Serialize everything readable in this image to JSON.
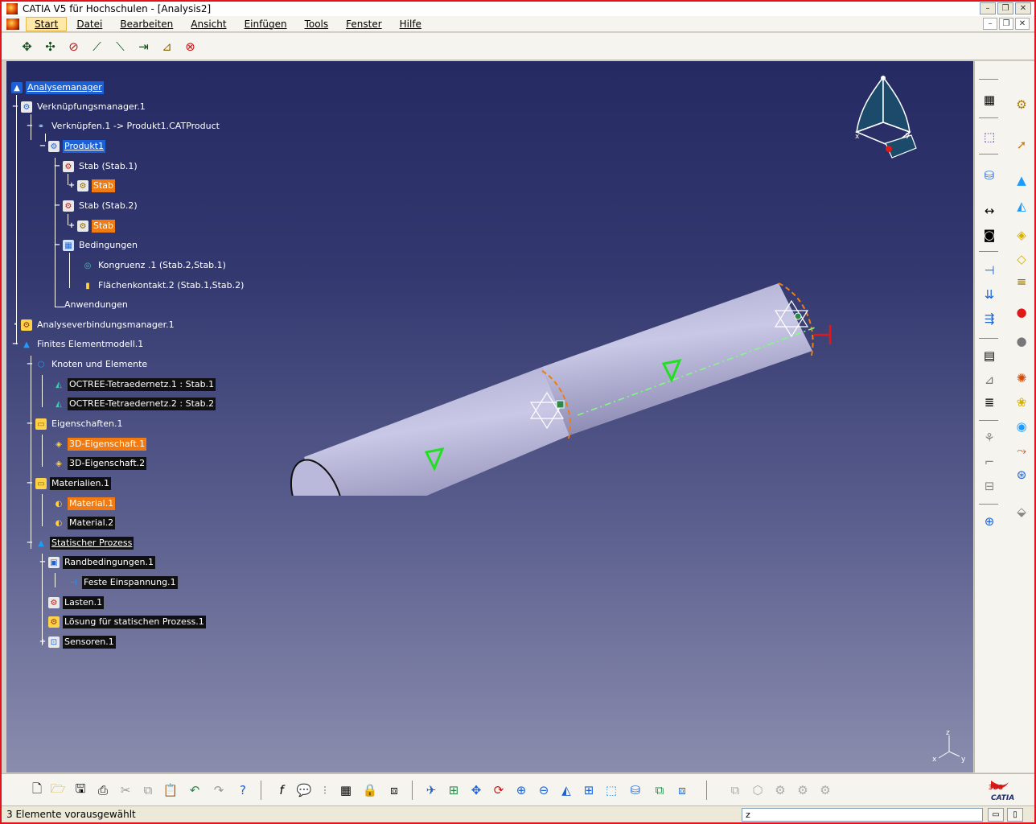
{
  "window": {
    "title": "CATIA V5 für Hochschulen - [Analysis2]",
    "minimize": "–",
    "restore": "❐",
    "close": "✕"
  },
  "menubar": {
    "items": [
      "Start",
      "Datei",
      "Bearbeiten",
      "Ansicht",
      "Einfügen",
      "Tools",
      "Fenster",
      "Hilfe"
    ],
    "active": "Start"
  },
  "tree": {
    "nodes": [
      {
        "label": "Analysemanager",
        "style": "hl",
        "icon": "analysis-manager-icon"
      },
      {
        "label": "Verknüpfungsmanager.1",
        "style": "plain",
        "icon": "link-manager-icon"
      },
      {
        "label": "Verknüpfen.1 -> Produkt1.CATProduct",
        "style": "plain",
        "icon": "link-icon"
      },
      {
        "label": "Produkt1",
        "style": "hl",
        "icon": "product-icon"
      },
      {
        "label": "Stab (Stab.1)",
        "style": "plain",
        "icon": "part-instance-icon"
      },
      {
        "label": "Stab",
        "style": "orange",
        "icon": "part-icon"
      },
      {
        "label": "Stab (Stab.2)",
        "style": "plain",
        "icon": "part-instance-icon"
      },
      {
        "label": "Stab",
        "style": "orange",
        "icon": "part-icon"
      },
      {
        "label": "Bedingungen",
        "style": "plain",
        "icon": "constraints-icon"
      },
      {
        "label": "Kongruenz .1 (Stab.2,Stab.1)",
        "style": "plain",
        "icon": "coincidence-icon"
      },
      {
        "label": "Flächenkontakt.2 (Stab.1,Stab.2)",
        "style": "plain",
        "icon": "contact-icon"
      },
      {
        "label": "Anwendungen",
        "style": "plain",
        "icon": ""
      },
      {
        "label": "Analyseverbindungsmanager.1",
        "style": "plain",
        "icon": "connection-manager-icon"
      },
      {
        "label": "Finites Elementmodell.1",
        "style": "plain",
        "icon": "fem-model-icon"
      },
      {
        "label": "Knoten und Elemente",
        "style": "plain",
        "icon": "nodes-elements-icon"
      },
      {
        "label": "OCTREE-Tetraedernetz.1 : Stab.1",
        "style": "dark",
        "icon": "mesh-icon"
      },
      {
        "label": "OCTREE-Tetraedernetz.2 : Stab.2",
        "style": "dark",
        "icon": "mesh-icon"
      },
      {
        "label": "Eigenschaften.1",
        "style": "plain",
        "icon": "properties-icon"
      },
      {
        "label": "3D-Eigenschaft.1",
        "style": "orange",
        "icon": "3d-property-icon"
      },
      {
        "label": "3D-Eigenschaft.2",
        "style": "dark",
        "icon": "3d-property-icon"
      },
      {
        "label": "Materialien.1",
        "style": "dark",
        "icon": "materials-icon"
      },
      {
        "label": "Material.1",
        "style": "orange",
        "icon": "material-icon"
      },
      {
        "label": "Material.2",
        "style": "dark",
        "icon": "material-icon"
      },
      {
        "label": "Statischer Prozess",
        "style": "dark",
        "icon": "static-case-icon"
      },
      {
        "label": "Randbedingungen.1",
        "style": "dark",
        "icon": "restraints-icon"
      },
      {
        "label": "Feste Einspannung.1",
        "style": "dark",
        "icon": "clamp-icon"
      },
      {
        "label": "Lasten.1",
        "style": "dark",
        "icon": "loads-icon"
      },
      {
        "label": "Lösung für statischen Prozess.1",
        "style": "dark",
        "icon": "solution-icon"
      },
      {
        "label": "Sensoren.1",
        "style": "dark",
        "icon": "sensors-icon"
      }
    ]
  },
  "compass": {
    "x_label": "x",
    "y_label": "y"
  },
  "axis_triad": {
    "x": "x",
    "y": "y",
    "z": "z"
  },
  "statusbar": {
    "message": "3 Elemente vorausgewählt",
    "command_value": "z"
  },
  "branding": {
    "logo_text": "CATIA",
    "logo_mark": "3DS"
  },
  "colors": {
    "selection_blue": "#1c62d6",
    "highlight_orange": "#f07b12",
    "viewport_top": "#262a63",
    "viewport_bottom": "#8b8dae"
  }
}
